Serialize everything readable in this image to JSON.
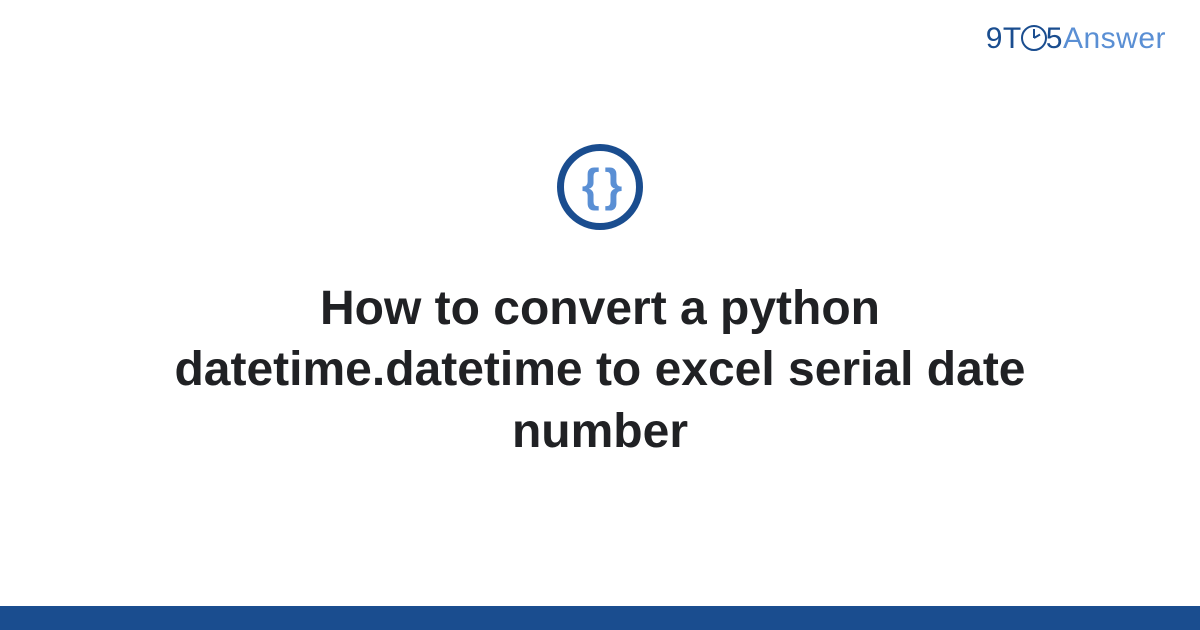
{
  "brand": {
    "part1": "9T",
    "part2": "5",
    "part3": "Answer"
  },
  "badge": {
    "glyph": "{ }",
    "semantic": "code-braces-icon"
  },
  "main": {
    "title": "How to convert a python datetime.datetime to excel serial date number"
  },
  "colors": {
    "brand_primary": "#1a4d8f",
    "brand_secondary": "#5a8fd4",
    "text": "#202124"
  }
}
